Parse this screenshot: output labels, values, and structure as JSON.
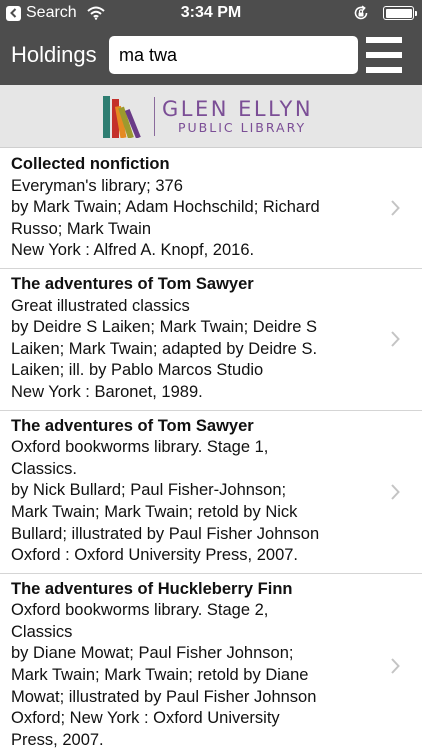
{
  "status_bar": {
    "back_label": "Search",
    "time": "3:34 PM"
  },
  "nav": {
    "title": "Holdings",
    "search_value": "ma twa"
  },
  "logo": {
    "line1": "GLEN ELLYN",
    "line2": "PUBLIC LIBRARY",
    "book_colors": [
      "#2f7e72",
      "#c4302b",
      "#e58a22",
      "#9c9a2e",
      "#6a3b87"
    ]
  },
  "results": [
    {
      "title": "Collected nonfiction",
      "lines": [
        "Everyman's library; 376",
        "by Mark Twain; Adam Hochschild; Richard",
        "Russo; Mark Twain",
        "New York : Alfred A. Knopf, 2016."
      ]
    },
    {
      "title": "The adventures of Tom Sawyer",
      "lines": [
        "Great illustrated classics",
        "by Deidre S Laiken; Mark Twain; Deidre S",
        "Laiken; Mark Twain; adapted by Deidre S.",
        "Laiken; ill. by Pablo Marcos Studio",
        "New York : Baronet, 1989."
      ]
    },
    {
      "title": "The adventures of Tom Sawyer",
      "lines": [
        "Oxford bookworms library. Stage 1,",
        "Classics.",
        "by Nick Bullard; Paul Fisher-Johnson;",
        "Mark Twain; Mark Twain; retold by Nick",
        "Bullard; illustrated by Paul Fisher Johnson",
        "Oxford : Oxford University Press, 2007."
      ]
    },
    {
      "title": "The adventures of Huckleberry Finn",
      "lines": [
        "Oxford bookworms library. Stage 2,",
        "Classics",
        "by Diane Mowat; Paul Fisher Johnson;",
        "Mark Twain; Mark Twain; retold by Diane",
        "Mowat; illustrated by Paul Fisher Johnson",
        "Oxford; New York : Oxford University",
        "Press, 2007."
      ]
    }
  ]
}
